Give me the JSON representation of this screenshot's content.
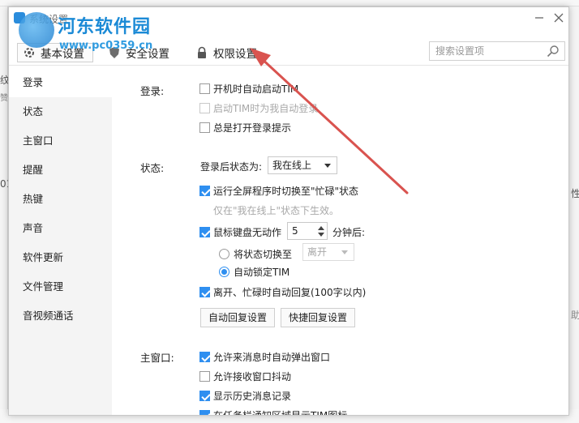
{
  "window": {
    "title": "系统设置"
  },
  "watermark": {
    "text": "河东软件园",
    "url": "www.pc0359.cn"
  },
  "tabs": [
    {
      "label": "基本设置",
      "active": true
    },
    {
      "label": "安全设置",
      "active": false
    },
    {
      "label": "权限设置",
      "active": false
    }
  ],
  "search": {
    "placeholder": "搜索设置项"
  },
  "sidebar": {
    "items": [
      {
        "label": "登录"
      },
      {
        "label": "状态"
      },
      {
        "label": "主窗口"
      },
      {
        "label": "提醒"
      },
      {
        "label": "热键"
      },
      {
        "label": "声音"
      },
      {
        "label": "软件更新"
      },
      {
        "label": "文件管理"
      },
      {
        "label": "音视频通话"
      }
    ]
  },
  "login": {
    "label": "登录:",
    "auto_start": "开机时自动启动TIM",
    "auto_login": "启动TIM时为我自动登录",
    "show_tip": "总是打开登录提示"
  },
  "status": {
    "label": "状态:",
    "after_login_label": "登录后状态为:",
    "after_login_value": "我在线上",
    "fullscreen_busy": "运行全屏程序时切换至\"忙碌\"状态",
    "fullscreen_note": "仅在\"我在线上\"状态下生效。",
    "idle_prefix": "鼠标键盘无动作",
    "idle_minutes": "5",
    "idle_suffix": "分钟后:",
    "switch_to": "将状态切换至",
    "switch_value": "离开",
    "auto_lock": "自动锁定TIM",
    "auto_reply": "离开、忙碌时自动回复(100字以内)",
    "auto_reply_btn": "自动回复设置",
    "quick_reply_btn": "快捷回复设置"
  },
  "main_window": {
    "label": "主窗口:",
    "popup_on_msg": "允许来消息时自动弹出窗口",
    "allow_shake": "允许接收窗口抖动",
    "show_history": "显示历史消息记录",
    "tray_icon": "在任务栏通知区域显示TIM图标"
  },
  "background": {
    "left_glyphs": [
      "纹",
      "赞",
      "01"
    ],
    "right_glyphs": [
      "性",
      "助"
    ]
  },
  "colors": {
    "accent": "#2f8ff0",
    "annotation_arrow": "#d9534f"
  }
}
